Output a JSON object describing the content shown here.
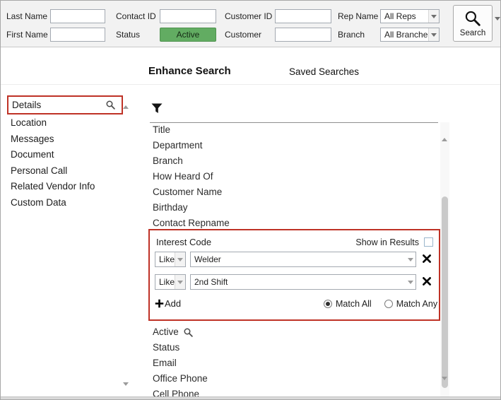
{
  "toolbar": {
    "last_name": {
      "label": "Last Name",
      "value": ""
    },
    "first_name": {
      "label": "First Name",
      "value": ""
    },
    "contact_id": {
      "label": "Contact ID",
      "value": ""
    },
    "status": {
      "label": "Status",
      "value": "Active"
    },
    "customer_id": {
      "label": "Customer ID",
      "value": ""
    },
    "customer": {
      "label": "Customer",
      "value": ""
    },
    "rep_name": {
      "label": "Rep Name",
      "value": "All Reps"
    },
    "branch": {
      "label": "Branch",
      "value": "All Branche"
    },
    "search_label": "Search"
  },
  "tabs": [
    {
      "label": "Enhance Search",
      "active": true
    },
    {
      "label": "Saved Searches",
      "active": false
    }
  ],
  "sidebar": {
    "items": [
      {
        "label": "Details",
        "highlighted": true
      },
      {
        "label": "Location"
      },
      {
        "label": "Messages"
      },
      {
        "label": "Document"
      },
      {
        "label": "Personal Call"
      },
      {
        "label": "Related Vendor Info"
      },
      {
        "label": "Custom Data"
      }
    ]
  },
  "field_list": {
    "items_above_panel": [
      "Title",
      "Department",
      "Branch",
      "How Heard Of",
      "Customer Name",
      "Birthday",
      "Contact Repname"
    ],
    "items_below_panel": [
      "Active",
      "Status",
      "Email",
      "Office Phone",
      "Cell Phone"
    ]
  },
  "interest_code_panel": {
    "title": "Interest Code",
    "show_in_results_label": "Show in Results",
    "show_in_results_checked": false,
    "filters": [
      {
        "operator": "Like",
        "value": "Welder"
      },
      {
        "operator": "Like",
        "value": "2nd Shift"
      }
    ],
    "add_label": "Add",
    "match_options": {
      "all": "Match All",
      "any": "Match Any",
      "selected": "Match All"
    }
  },
  "colors": {
    "status_active_green": "#62ac62",
    "annotation_red": "#bf3226",
    "toolbar_background": "#f2f2f2"
  }
}
